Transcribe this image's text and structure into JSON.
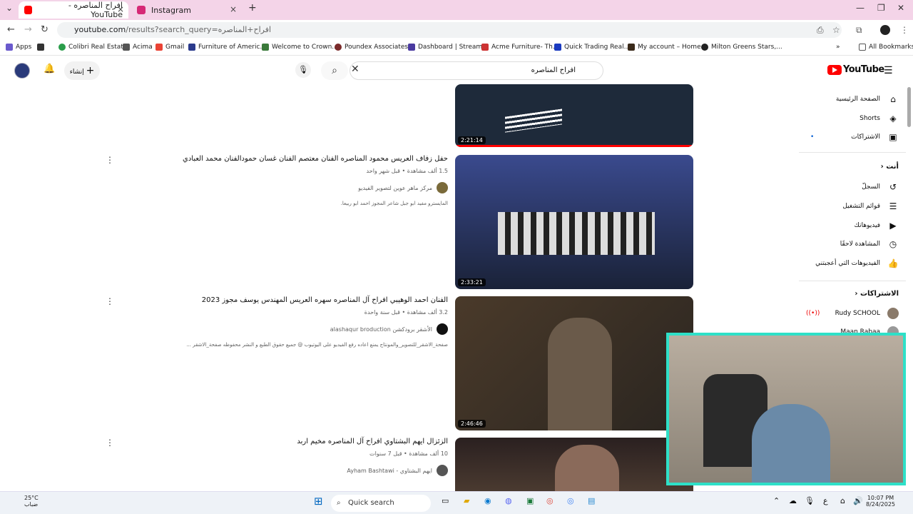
{
  "tabs": [
    {
      "title": "افراح المناصره - YouTube",
      "color": "#ff0000"
    },
    {
      "title": "Instagram",
      "color": "#d62976"
    }
  ],
  "address": {
    "host": "youtube.com",
    "path": "/results?search_query=افراح+المناصره"
  },
  "bookmarks": [
    {
      "label": "Apps"
    },
    {
      "label": "Colibri Real Estate"
    },
    {
      "label": "Acima"
    },
    {
      "label": "Gmail"
    },
    {
      "label": "Furniture of Americ..."
    },
    {
      "label": "Welcome to Crown..."
    },
    {
      "label": "Poundex Associates..."
    },
    {
      "label": "Dashboard | Stream..."
    },
    {
      "label": "Acme Furniture- Th..."
    },
    {
      "label": "Quick Trading Real..."
    },
    {
      "label": "My account – Home..."
    },
    {
      "label": "Milton Greens Stars,..."
    },
    {
      "label": "All Bookmarks"
    }
  ],
  "header": {
    "logo": "YouTube",
    "search_value": "افراح المناصره",
    "create_label": "إنشاء"
  },
  "sidebar": {
    "items": [
      {
        "label": "الصفحة الرئيسية",
        "icon": "⌂"
      },
      {
        "label": "Shorts",
        "icon": "◈"
      },
      {
        "label": "الاشتراكات",
        "icon": "▣"
      }
    ],
    "you_header": "أنت",
    "you_items": [
      {
        "label": "السجلّ",
        "icon": "↺"
      },
      {
        "label": "قوائم التشغيل",
        "icon": "☰"
      },
      {
        "label": "فيديوهاتك",
        "icon": "▶"
      },
      {
        "label": "المشاهدة لاحقًا",
        "icon": "◷"
      },
      {
        "label": "الفيديوهات التي أعجبتني",
        "icon": "👍"
      }
    ],
    "subs_header": "الاشتراكات",
    "subs": [
      {
        "label": "Rudy SCHOOL"
      },
      {
        "label": "Maan Rabaa"
      }
    ]
  },
  "videos": [
    {
      "title": "",
      "meta": "",
      "channel": "",
      "desc": "",
      "duration": "2:21:14",
      "thumb_color": "#1e2a3a"
    },
    {
      "title": "حفل زفاف العريس محمود المناصره الفنان معتصم الفنان غسان حمودالفنان محمد العبادي",
      "meta": "1.5 ألف مشاهدة • قبل شهر واحد",
      "channel": "مركز ماهر عوين لتصوير الفيديو",
      "desc": "المايسترو مفيد ابو جبل شاعر المجوز احمد ابو ربيعا.",
      "duration": "2:33:21",
      "thumb_color": "#283a5e"
    },
    {
      "title": "الفنان احمد الوهيبي افراح آل المناصره سهره العريس المهندس يوسف مجوز 2023",
      "meta": "3.2 ألف مشاهدة • قبل سنة واحدة",
      "channel": "الأشقر برودكشن alashaqur broduction",
      "desc": "صفحة_الاشقر_للتصوير_والمونتاج يمنع اعاده رفع الفيديو على اليوتيوب @ جميع حقوق الطبع و النشر محفوظه صفحة_الاشقر ...",
      "duration": "2:46:46",
      "thumb_color": "#3a3028"
    },
    {
      "title": "الزئزال ايهم البشتاوي افراح آل المناصره مخيم اربد",
      "meta": "10 ألف مشاهدة • قبل 7 سنوات",
      "channel": "ايهم البشتاوي - Ayham Bashtawi",
      "desc": "",
      "duration": "",
      "thumb_color": "#2a2020"
    }
  ],
  "taskbar": {
    "search_placeholder": "Quick search",
    "weather_temp": "25°C",
    "weather_desc": "ضباب",
    "time": "10:07 PM",
    "date": "8/24/2025"
  }
}
